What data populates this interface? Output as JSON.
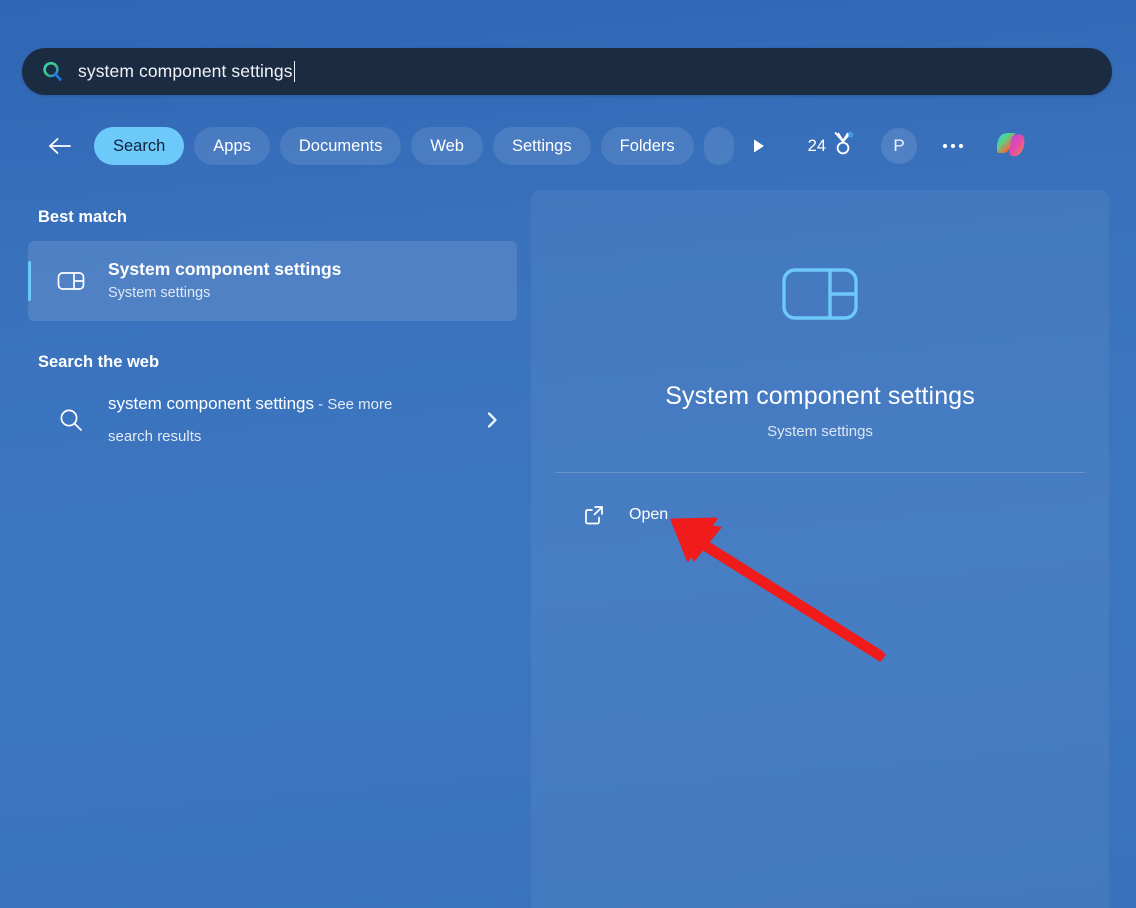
{
  "search": {
    "value": "system component settings",
    "icon": "search-icon",
    "has_caret": true
  },
  "tabs": {
    "back_icon": "back-arrow-icon",
    "items": [
      {
        "label": "Search",
        "active": true
      },
      {
        "label": "Apps",
        "active": false
      },
      {
        "label": "Documents",
        "active": false
      },
      {
        "label": "Web",
        "active": false
      },
      {
        "label": "Settings",
        "active": false
      },
      {
        "label": "Folders",
        "active": false
      },
      {
        "label": "",
        "active": false,
        "clipped": true
      }
    ],
    "next_icon": "play-arrow-icon",
    "rewards": {
      "count": "24",
      "icon": "medal-icon",
      "has_badge": true
    },
    "avatar": {
      "initial": "P"
    },
    "more_icon": "more-options-icon",
    "copilot_icon": "copilot-icon"
  },
  "results": {
    "best_match_heading": "Best match",
    "best_match": {
      "title": "System component settings",
      "subtitle": "System settings",
      "icon": "system-component-settings-icon",
      "selected": true
    },
    "web_heading": "Search the web",
    "web_result": {
      "query": "system component settings",
      "suffix": " - See more search results",
      "icon": "search-icon",
      "chevron_icon": "chevron-right-icon"
    }
  },
  "preview": {
    "icon": "system-component-settings-icon",
    "title": "System component settings",
    "subtitle": "System settings",
    "actions": [
      {
        "label": "Open",
        "icon": "open-external-icon"
      }
    ]
  },
  "annotation": {
    "arrow_color": "#f01b1b",
    "points_to": "Open"
  },
  "colors": {
    "background": "#3a72bd",
    "searchbar": "#1b2b42",
    "accent": "#6ec9fb",
    "active_tab_text": "#10233c",
    "preview_icon": "#6ec9fb"
  }
}
